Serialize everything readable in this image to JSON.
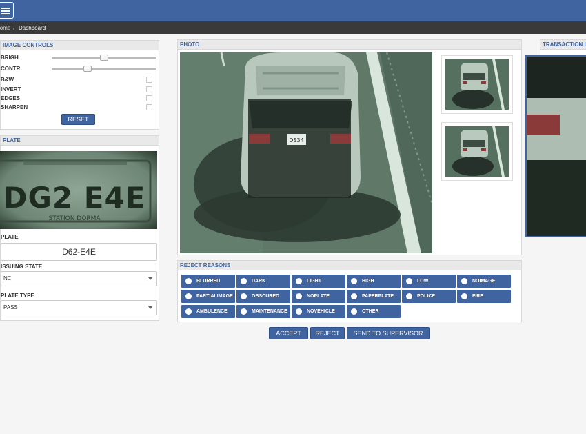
{
  "breadcrumb": {
    "home": "Home",
    "separator": "/",
    "current": "Dashboard"
  },
  "image_controls": {
    "title": "IMAGE CONTROLS",
    "brightness_label": "BRIGH.",
    "brightness_value": 0.5,
    "contrast_label": "CONTR.",
    "contrast_value": 0.33,
    "bw_label": "B&W",
    "invert_label": "INVERT",
    "edges_label": "EDGES",
    "sharpen_label": "SHARPEN",
    "reset_label": "RESET"
  },
  "plate_panel": {
    "title": "PLATE",
    "plate_label": "PLATE",
    "plate_value": "D62-E4E",
    "issuing_state_label": "ISSUING STATE",
    "issuing_state_value": "NC",
    "plate_type_label": "PLATE TYPE",
    "plate_type_value": "PASS",
    "plate_image_text": "DG2 E4E",
    "plate_image_bottom_text": "STATION DORMA"
  },
  "photo": {
    "title": "PHOTO",
    "car_plate_text": "DS34"
  },
  "transaction": {
    "title": "TRANSACTION INFO"
  },
  "reject_reasons": {
    "title": "REJECT REASONS",
    "items": [
      "BLURRED",
      "DARK",
      "LIGHT",
      "HIGH",
      "LOW",
      "NOIMAGE",
      "PARTIALIMAGE",
      "OBSCURED",
      "NOPLATE",
      "PAPERPLATE",
      "POLICE",
      "FIRE",
      "AMBULENCE",
      "MAINTENANCE",
      "NOVEHICLE",
      "OTHER"
    ]
  },
  "actions": {
    "accept": "ACCEPT",
    "reject": "REJECT",
    "send": "SEND TO SUPERVISOR"
  },
  "colors": {
    "accent": "#3f64a0",
    "breadcrumb_bg": "#3a3a3a",
    "panel_header": "#e9e9e9"
  },
  "icons": {
    "menu": "hamburger-icon",
    "radio": "radio-dot-icon",
    "caret": "chevron-down-icon"
  }
}
